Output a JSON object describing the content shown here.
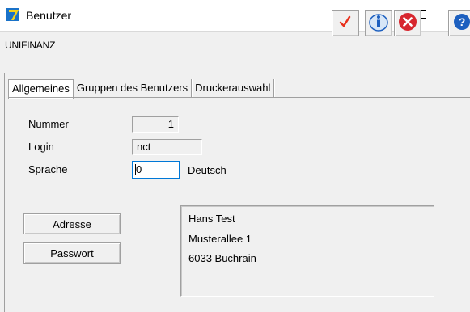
{
  "window": {
    "title": "Benutzer",
    "controls": {
      "minimize": "—",
      "maximize": "☐",
      "close": "✕"
    }
  },
  "toolbar": {
    "company": "UNIFINANZ",
    "buttons": [
      {
        "name": "ok",
        "icon": "checkmark-icon",
        "color": "#e8301c"
      },
      {
        "name": "info",
        "icon": "info-icon",
        "color": "#1c5fbf"
      },
      {
        "name": "cancel",
        "icon": "cancel-icon",
        "color": "#d7262e"
      },
      {
        "name": "help",
        "icon": "help-icon",
        "color": "#1c5fbf"
      }
    ]
  },
  "tabs": [
    {
      "label": "Allgemeines",
      "active": true
    },
    {
      "label": "Gruppen des Benutzers",
      "active": false
    },
    {
      "label": "Druckerauswahl",
      "active": false
    }
  ],
  "form": {
    "nummer_label": "Nummer",
    "nummer_value": "1",
    "login_label": "Login",
    "login_value": "nct",
    "sprache_label": "Sprache",
    "sprache_value": "0",
    "sprache_text": "Deutsch"
  },
  "buttons": {
    "adresse": "Adresse",
    "passwort": "Passwort"
  },
  "address": {
    "name": "Hans Test",
    "street": "Musterallee 1",
    "city": "6033 Buchrain"
  },
  "colors": {
    "focus_border": "#0078d7",
    "background": "#f0f0f0"
  }
}
